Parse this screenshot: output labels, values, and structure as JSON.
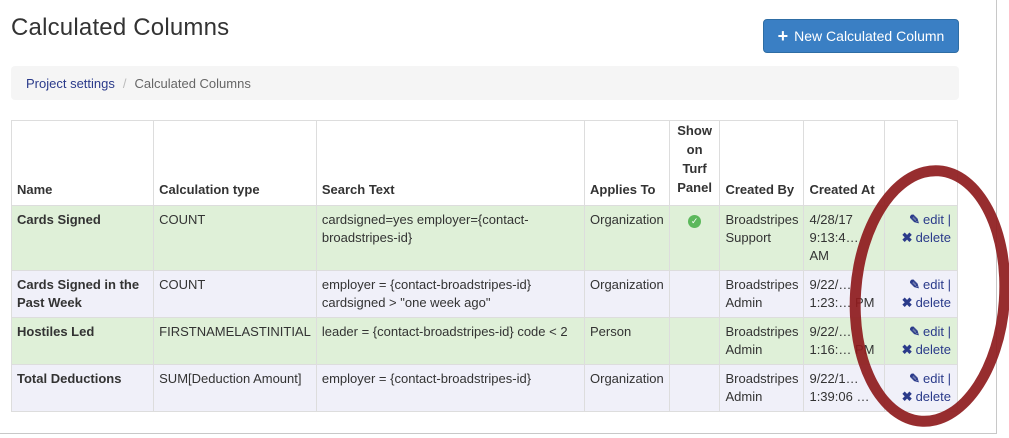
{
  "page": {
    "title": "Calculated Columns"
  },
  "toolbar": {
    "new_button_label": "New Calculated Column",
    "new_button_icon": "plus-icon"
  },
  "breadcrumb": {
    "parent": "Project settings",
    "current": "Calculated Columns"
  },
  "table": {
    "headers": {
      "name": "Name",
      "calc_type": "Calculation type",
      "search_text": "Search Text",
      "applies_to": "Applies To",
      "show_l1": "Show",
      "show_l2": "on",
      "show_l3": "Turf",
      "show_l4": "Panel",
      "created_by": "Created By",
      "created_at": "Created At"
    },
    "actions": {
      "edit": "edit |",
      "delete": "delete"
    },
    "rows": [
      {
        "name": "Cards Signed",
        "calc_type": "COUNT",
        "search_text": "cardsigned=yes employer={contact-broadstripes-id}",
        "applies_to": "Organization",
        "show_on_turf": true,
        "created_by": "Broadstripes Support",
        "created_at": "4/28/17\n9:13:4… AM"
      },
      {
        "name": "Cards Signed in the Past Week",
        "calc_type": "COUNT",
        "search_text": "employer = {contact-broadstripes-id} cardsigned > \"one week ago\"",
        "applies_to": "Organization",
        "show_on_turf": false,
        "created_by": "Broadstripes Admin",
        "created_at": "9/22/…\n1:23:… PM"
      },
      {
        "name": "Hostiles Led",
        "calc_type": "FIRSTNAMELASTINITIAL",
        "search_text": "leader = {contact-broadstripes-id} code < 2",
        "applies_to": "Person",
        "show_on_turf": false,
        "created_by": "Broadstripes Admin",
        "created_at": "9/22/…\n1:16:… PM"
      },
      {
        "name": "Total Deductions",
        "calc_type": "SUM[Deduction Amount]",
        "search_text": "employer = {contact-broadstripes-id}",
        "applies_to": "Organization",
        "show_on_turf": false,
        "created_by": "Broadstripes Admin",
        "created_at": "9/22/1…\n1:39:06 …"
      }
    ]
  },
  "colors": {
    "primary_button": "#3a7fc4",
    "row_green": "#dff0d8",
    "row_blue": "#f0f0f9",
    "annotation_circle": "#8e1b1d",
    "link": "#2a3a8a"
  }
}
